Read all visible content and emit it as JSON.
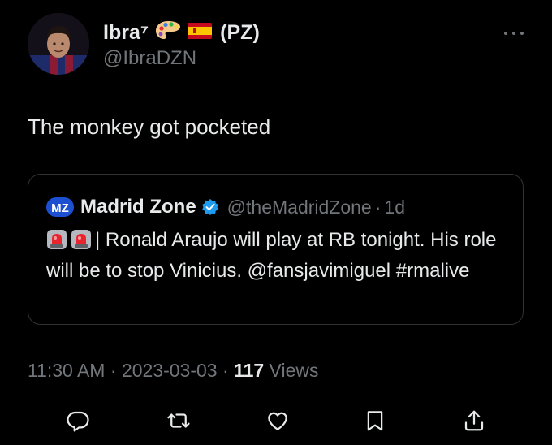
{
  "author": {
    "display_name": "Ibra⁷",
    "suffix": "(PZ)",
    "handle": "@IbraDZN"
  },
  "tweet": {
    "text": "The monkey got pocketed"
  },
  "quoted_tweet": {
    "name": "Madrid Zone",
    "handle": "@theMadridZone",
    "separator": "·",
    "time": "1d",
    "body_text": "| Ronald Araujo will play at RB tonight. His role will be to stop Vinicius. @fansjavimiguel #rmalive"
  },
  "meta": {
    "time": "11:30 AM",
    "date": "2023-03-03",
    "separator": "·",
    "views_count": "117",
    "views_label": "Views"
  },
  "actions": [
    "reply-icon",
    "retweet-icon",
    "like-icon",
    "bookmark-icon",
    "share-icon"
  ],
  "colors": {
    "background": "#000000",
    "text": "#e7e9ea",
    "muted": "#71767b",
    "border": "#2f3336",
    "verified": "#1d9bf0"
  }
}
